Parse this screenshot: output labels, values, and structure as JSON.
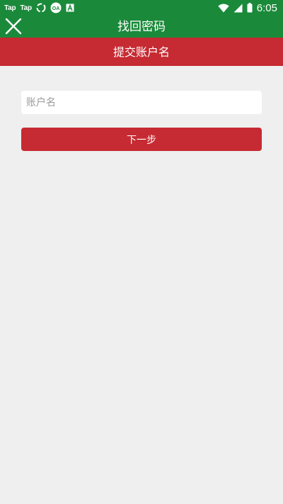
{
  "status_bar": {
    "notifications": [
      "Tap",
      "Tap"
    ],
    "time": "6:05",
    "color": "#1a8a3a"
  },
  "toolbar": {
    "title": "找回密码",
    "close_icon": "close-icon",
    "color": "#1a8a3a"
  },
  "step": {
    "title": "提交账户名",
    "color": "#c62a32"
  },
  "form": {
    "account_placeholder": "账户名",
    "account_value": "",
    "next_label": "下一步"
  }
}
